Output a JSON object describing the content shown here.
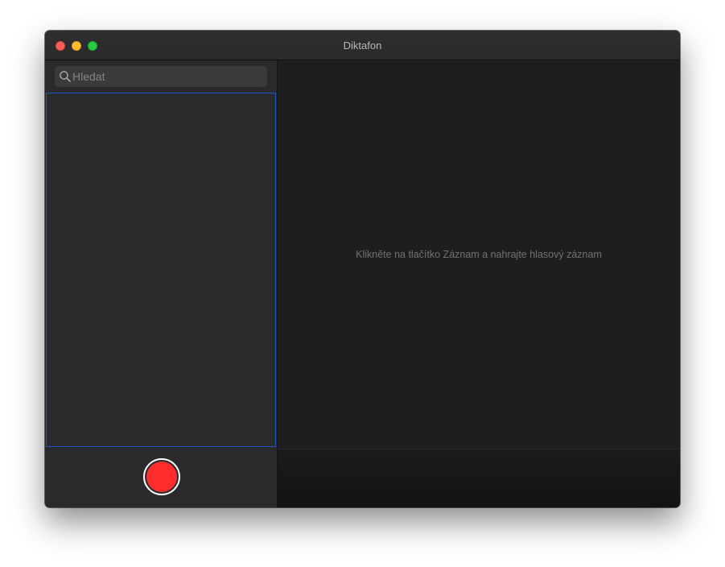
{
  "window": {
    "title": "Diktafon"
  },
  "search": {
    "placeholder": "Hledat",
    "value": ""
  },
  "main": {
    "empty_hint": "Klikněte na tlačítko Záznam a nahrajte hlasový záznam"
  },
  "icons": {
    "search": "search-icon",
    "record": "record-icon"
  },
  "colors": {
    "record": "#fe2c2c",
    "selection_border": "#1f57c8",
    "traffic_close": "#fe5f57",
    "traffic_minimize": "#febc2e",
    "traffic_zoom": "#28c840"
  }
}
